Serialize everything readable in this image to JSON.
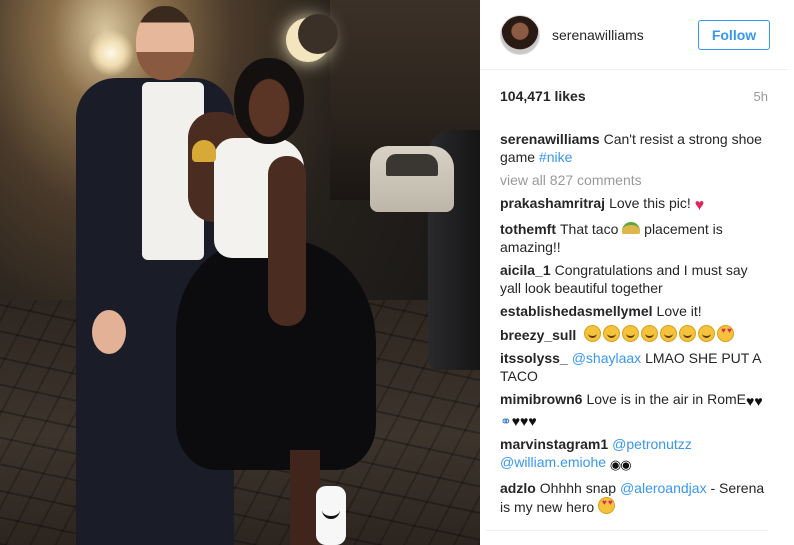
{
  "post": {
    "username": "serenawilliams",
    "follow_label": "Follow",
    "likes": "104,471 likes",
    "time": "5h",
    "caption": {
      "user": "serenawilliams",
      "text": "Can't resist a strong shoe game",
      "hashtag": "#nike"
    },
    "view_all": "view all 827 comments"
  },
  "comments": [
    {
      "user": "prakashamritraj",
      "text": "Love this pic!"
    },
    {
      "user": "tothemft",
      "text_before": "That taco",
      "text_after": "placement is amazing!!"
    },
    {
      "user": "aicila_1",
      "text": "Congratulations and I must say yall look beautiful together"
    },
    {
      "user": "establishedasmellymel",
      "text": "Love it!"
    },
    {
      "user": "breezy_sull"
    },
    {
      "user": "itssolyss_",
      "mention": "@shaylaax",
      "text": "LMAO SHE PUT A TACO"
    },
    {
      "user": "mimibrown6",
      "text": "Love is in the air in RomE"
    },
    {
      "user": "marvinstagram1",
      "mention": "@petronutzz",
      "mention2": "@william.emiohe"
    },
    {
      "user": "adzlo",
      "text": "Ohhhh snap",
      "mention": "@aleroandjax",
      "text_after": "- Serena is my new hero"
    }
  ],
  "icons": {
    "heart": "red-heart-emoji",
    "taco": "taco-emoji",
    "smile": "smiling-face-emoji",
    "heart_eyes": "heart-eyes-emoji",
    "eyes": "eyes-emoji",
    "ring": "ring-emoji",
    "couple": "couple-with-heart-emoji"
  },
  "colors": {
    "accent": "#3897f0",
    "muted": "#999999",
    "text": "#262626",
    "heart": "#e0245e"
  }
}
